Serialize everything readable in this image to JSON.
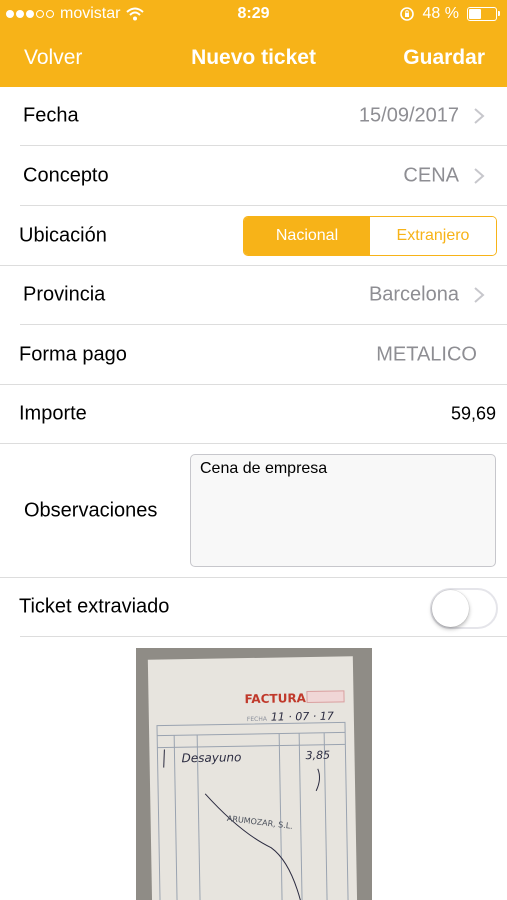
{
  "status_bar": {
    "carrier": "movistar",
    "time": "8:29",
    "battery": "48 %"
  },
  "nav": {
    "back": "Volver",
    "title": "Nuevo ticket",
    "save": "Guardar"
  },
  "rows": {
    "fecha": {
      "label": "Fecha",
      "value": "15/09/2017"
    },
    "concepto": {
      "label": "Concepto",
      "value": "CENA"
    },
    "ubicacion": {
      "label": "Ubicación",
      "options": [
        "Nacional",
        "Extranjero"
      ],
      "selected": "Nacional"
    },
    "provincia": {
      "label": "Provincia",
      "value": "Barcelona"
    },
    "forma_pago": {
      "label": "Forma pago",
      "value": "METALICO"
    },
    "importe": {
      "label": "Importe",
      "value": "59,69"
    },
    "observaciones": {
      "label": "Observaciones",
      "value": "Cena de empresa"
    },
    "ticket_extraviado": {
      "label": "Ticket extraviado",
      "on": false
    }
  },
  "receipt": {
    "header": "FACTURA N.º",
    "fecha_label": "FECHA",
    "fecha_value": "11 · 07 · 17",
    "line_item": "Desayuno",
    "amount": "3,85",
    "company": "ARUMOZAR, S.L."
  },
  "colors": {
    "accent": "#F7B318",
    "separator": "#DDDDDD",
    "value_gray": "#8E8E93"
  }
}
